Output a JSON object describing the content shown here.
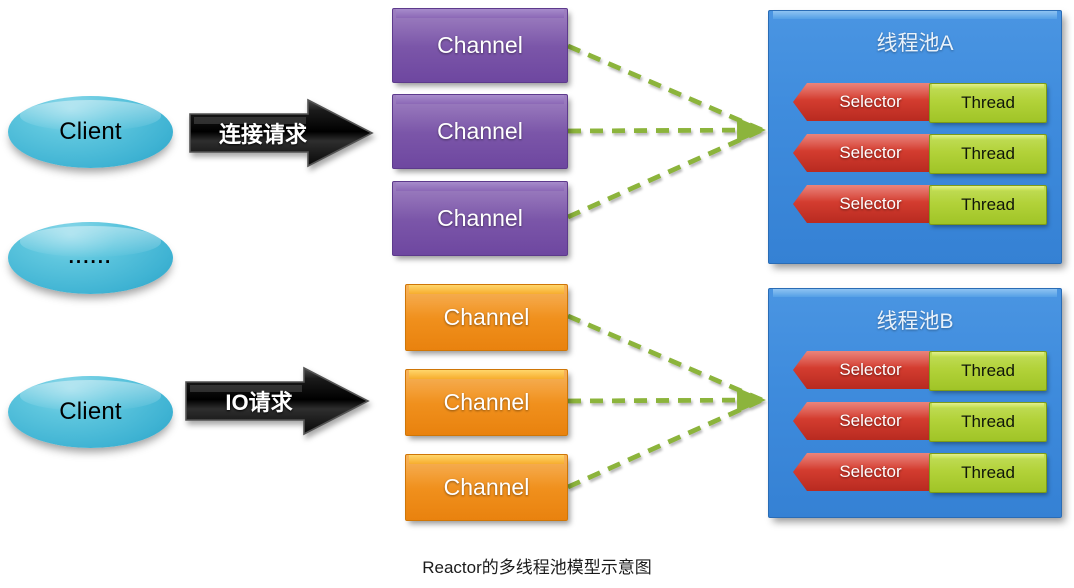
{
  "diagram": {
    "caption": "Reactor的多线程池模型示意图",
    "background_color": "#ffffff",
    "clients": [
      {
        "label": "Client",
        "kind": "client-ellipse"
      },
      {
        "label": "......",
        "kind": "client-ellipse-ellipsis"
      },
      {
        "label": "Client",
        "kind": "client-ellipse"
      }
    ],
    "request_arrows": [
      {
        "label": "连接请求",
        "color": "#101010"
      },
      {
        "label": "IO请求",
        "color": "#101010"
      }
    ],
    "channel_groups": [
      {
        "name": "connection-channels",
        "color": "#7d58aa",
        "channels": [
          {
            "label": "Channel"
          },
          {
            "label": "Channel"
          },
          {
            "label": "Channel"
          }
        ]
      },
      {
        "name": "io-channels",
        "color": "#f1921f",
        "channels": [
          {
            "label": "Channel"
          },
          {
            "label": "Channel"
          },
          {
            "label": "Channel"
          }
        ]
      }
    ],
    "thread_pools": [
      {
        "title": "线程池A",
        "color": "#3f8cdd",
        "rows": [
          {
            "selector": "Selector",
            "thread": "Thread"
          },
          {
            "selector": "Selector",
            "thread": "Thread"
          },
          {
            "selector": "Selector",
            "thread": "Thread"
          }
        ]
      },
      {
        "title": "线程池B",
        "color": "#3f8cdd",
        "rows": [
          {
            "selector": "Selector",
            "thread": "Thread"
          },
          {
            "selector": "Selector",
            "thread": "Thread"
          },
          {
            "selector": "Selector",
            "thread": "Thread"
          }
        ]
      }
    ],
    "connector_color": "#8cb43c",
    "selector_color": "#d33c2f",
    "thread_color": "#b2d239"
  }
}
